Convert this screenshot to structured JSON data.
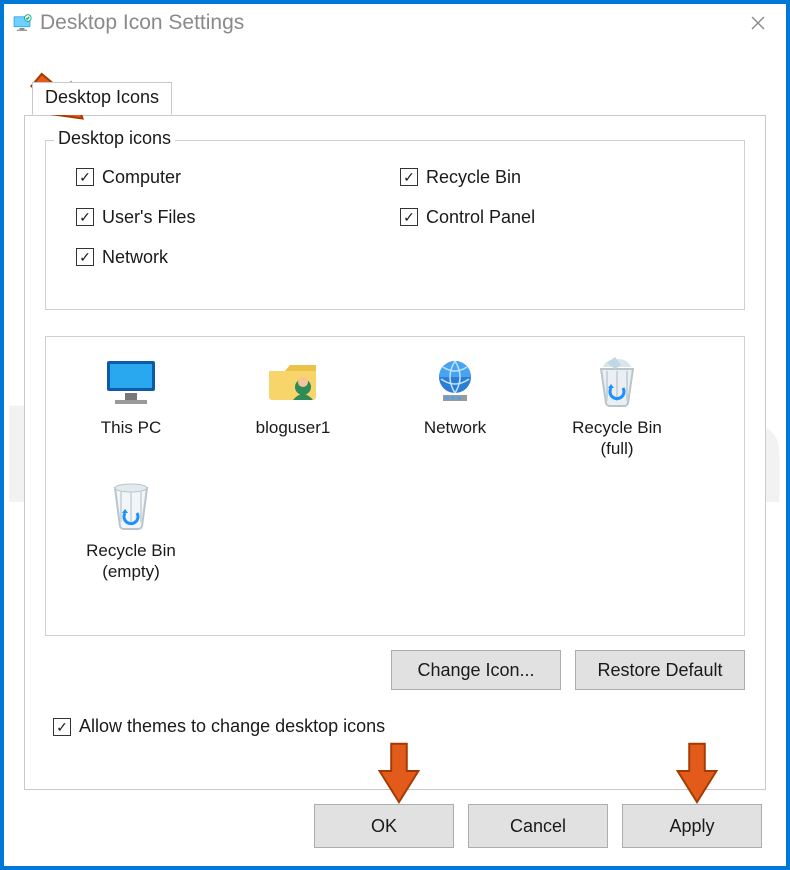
{
  "window": {
    "title": "Desktop Icon Settings"
  },
  "tab": {
    "label": "Desktop Icons"
  },
  "group": {
    "legend": "Desktop icons",
    "checks": {
      "computer": {
        "label": "Computer",
        "checked": true
      },
      "recycle_bin": {
        "label": "Recycle Bin",
        "checked": true
      },
      "users_files": {
        "label": "User's Files",
        "checked": true
      },
      "control_panel": {
        "label": "Control Panel",
        "checked": true
      },
      "network": {
        "label": "Network",
        "checked": true
      }
    }
  },
  "icons": {
    "this_pc": {
      "label": "This PC"
    },
    "bloguser": {
      "label": "bloguser1"
    },
    "network": {
      "label": "Network"
    },
    "recycle_full": {
      "label": "Recycle Bin\n(full)"
    },
    "recycle_empty": {
      "label": "Recycle Bin\n(empty)"
    }
  },
  "buttons": {
    "change_icon": "Change Icon...",
    "restore_default": "Restore Default",
    "ok": "OK",
    "cancel": "Cancel",
    "apply": "Apply"
  },
  "allow_themes": {
    "label": "Allow themes to change desktop icons",
    "checked": true
  },
  "watermark": "PCrisk.com"
}
